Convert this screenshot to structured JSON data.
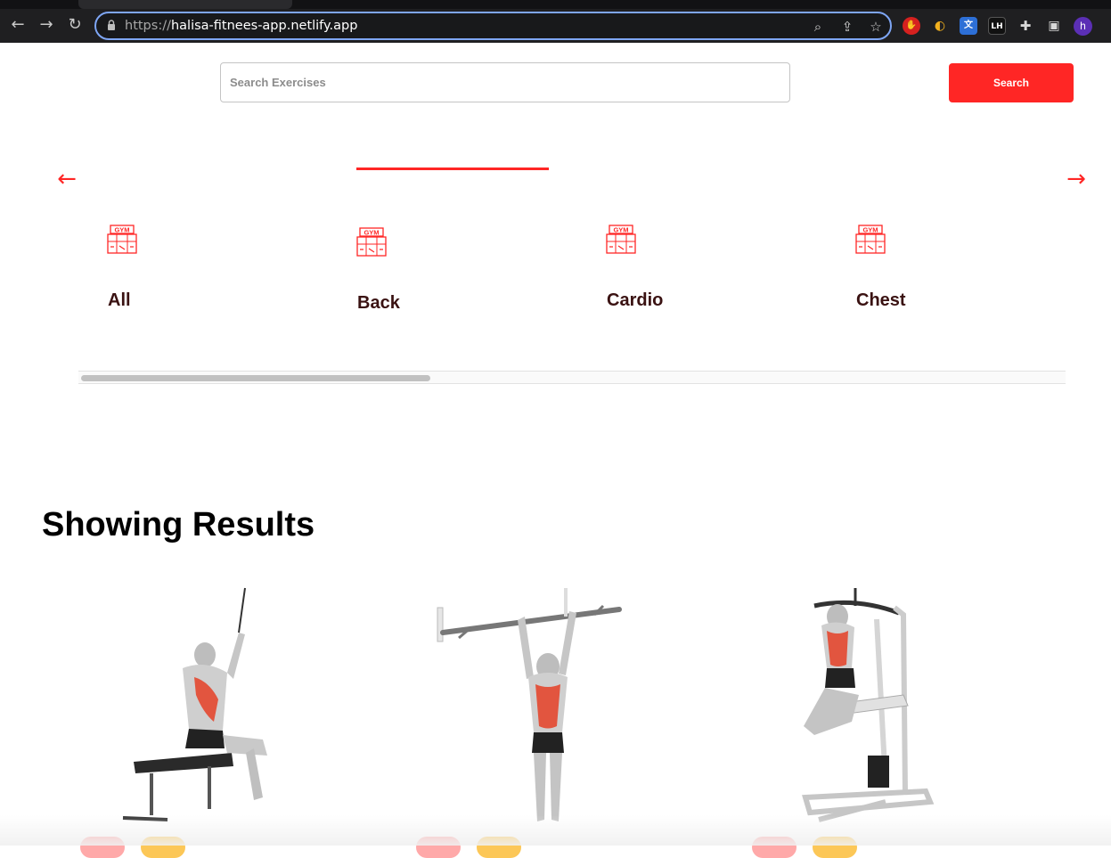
{
  "browser": {
    "url_scheme": "https://",
    "url_host": "halisa-fitnees-app.netlify.app",
    "profile_initial": "h",
    "extensions": [
      "adblock-icon",
      "extension-q-icon",
      "translate-icon",
      "lighthouse-icon",
      "puzzle-icon"
    ]
  },
  "search": {
    "placeholder": "Search Exercises",
    "button_label": "Search"
  },
  "body_parts": {
    "prev_arrow": "←",
    "next_arrow": "→",
    "active_index": 1,
    "items": [
      {
        "label": "All"
      },
      {
        "label": "Back"
      },
      {
        "label": "Cardio"
      },
      {
        "label": "Chest"
      }
    ],
    "icon_text": "GYM"
  },
  "results": {
    "title": "Showing Results",
    "cards": [
      {
        "exercise": "seated-lat-pulldown",
        "tags": [
          "red",
          "yellow"
        ]
      },
      {
        "exercise": "pull-up",
        "tags": [
          "red",
          "yellow"
        ]
      },
      {
        "exercise": "assisted-pull-up",
        "tags": [
          "red",
          "yellow"
        ]
      }
    ]
  },
  "colors": {
    "accent": "#ff2625",
    "label": "#3a1212",
    "pill_red": "#ffa9a9",
    "pill_yellow": "#fcc757"
  }
}
